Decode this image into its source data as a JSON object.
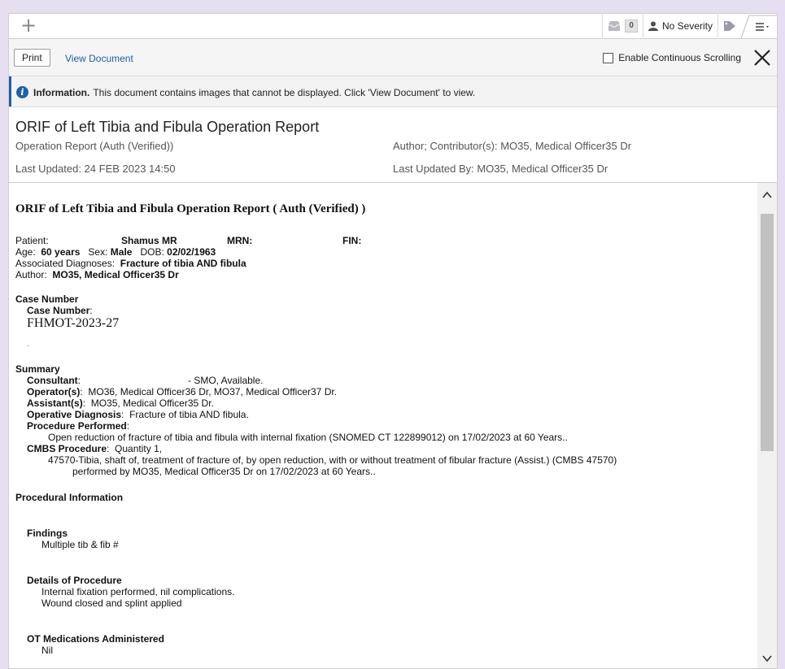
{
  "tabbar": {
    "inbox_count": "0",
    "severity": "No Severity"
  },
  "toolbar": {
    "print_label": "Print",
    "view_document_label": "View Document",
    "continuous_scroll_label": "Enable Continuous Scrolling"
  },
  "info": {
    "title": "Information.",
    "message": "This document contains images that cannot be displayed. Click 'View Document' to view."
  },
  "header": {
    "title": "ORIF of Left Tibia and Fibula Operation Report",
    "type": "Operation Report (Auth (Verified))",
    "last_updated": "Last Updated: 24 FEB 2023 14:50",
    "author": "Author; Contributor(s): MO35, Medical Officer35 Dr",
    "last_updated_by": "Last Updated By: MO35, Medical Officer35 Dr"
  },
  "report": {
    "title": "ORIF of Left Tibia and Fibula Operation Report ( Auth (Verified) )",
    "patient_label": "Patient:",
    "patient_name": "Shamus  MR",
    "mrn_label": "MRN:",
    "fin_label": "FIN:",
    "age_label": "Age:",
    "age_value": "60 years",
    "sex_label": "Sex:",
    "sex_value": "Male",
    "dob_label": "DOB:",
    "dob_value": "02/02/1963",
    "diag_label": "Associated Diagnoses:",
    "diag_value": "Fracture of tibia AND fibula",
    "author_label": "Author:",
    "author_value": "MO35, Medical Officer35  Dr",
    "case_heading": "Case Number",
    "case_label": "Case Number",
    "case_value": "FHMOT-2023-27",
    "case_dot": ".",
    "summary_heading": "Summary",
    "consultant_label": "Consultant",
    "consultant_value": "- SMO, Available.",
    "operators_label": "Operator(s)",
    "operators_value": "MO36, Medical Officer36  Dr, MO37, Medical Officer37  Dr.",
    "assistants_label": "Assistant(s)",
    "assistants_value": "MO35, Medical Officer35  Dr.",
    "op_diag_label": "Operative Diagnosis",
    "op_diag_value": "Fracture of tibia AND fibula.",
    "proc_label": "Procedure Performed",
    "proc_value": "Open reduction of fracture of tibia and fibula with internal fixation (SNOMED CT 122899012) on 17/02/2023 at 60 Years..",
    "cmbs_label": "CMBS Procedure",
    "cmbs_value": "Quantity 1,",
    "cmbs_line1": "47570-Tibia, shaft of, treatment of fracture of, by open reduction, with or without treatment of fibular fracture (Assist.) (CMBS 47570)",
    "cmbs_line2": "performed by MO35, Medical Officer35  Dr on 17/02/2023 at 60 Years..",
    "procedural_heading": "Procedural Information",
    "findings_heading": "Findings",
    "findings_value": "Multiple tib & fib #",
    "details_heading": "Details of Procedure",
    "details_line1": "Internal fixation performed, nil complications.",
    "details_line2": "Wound closed and splint applied",
    "meds_heading": "OT Medications Administered",
    "meds_value": "Nil"
  }
}
